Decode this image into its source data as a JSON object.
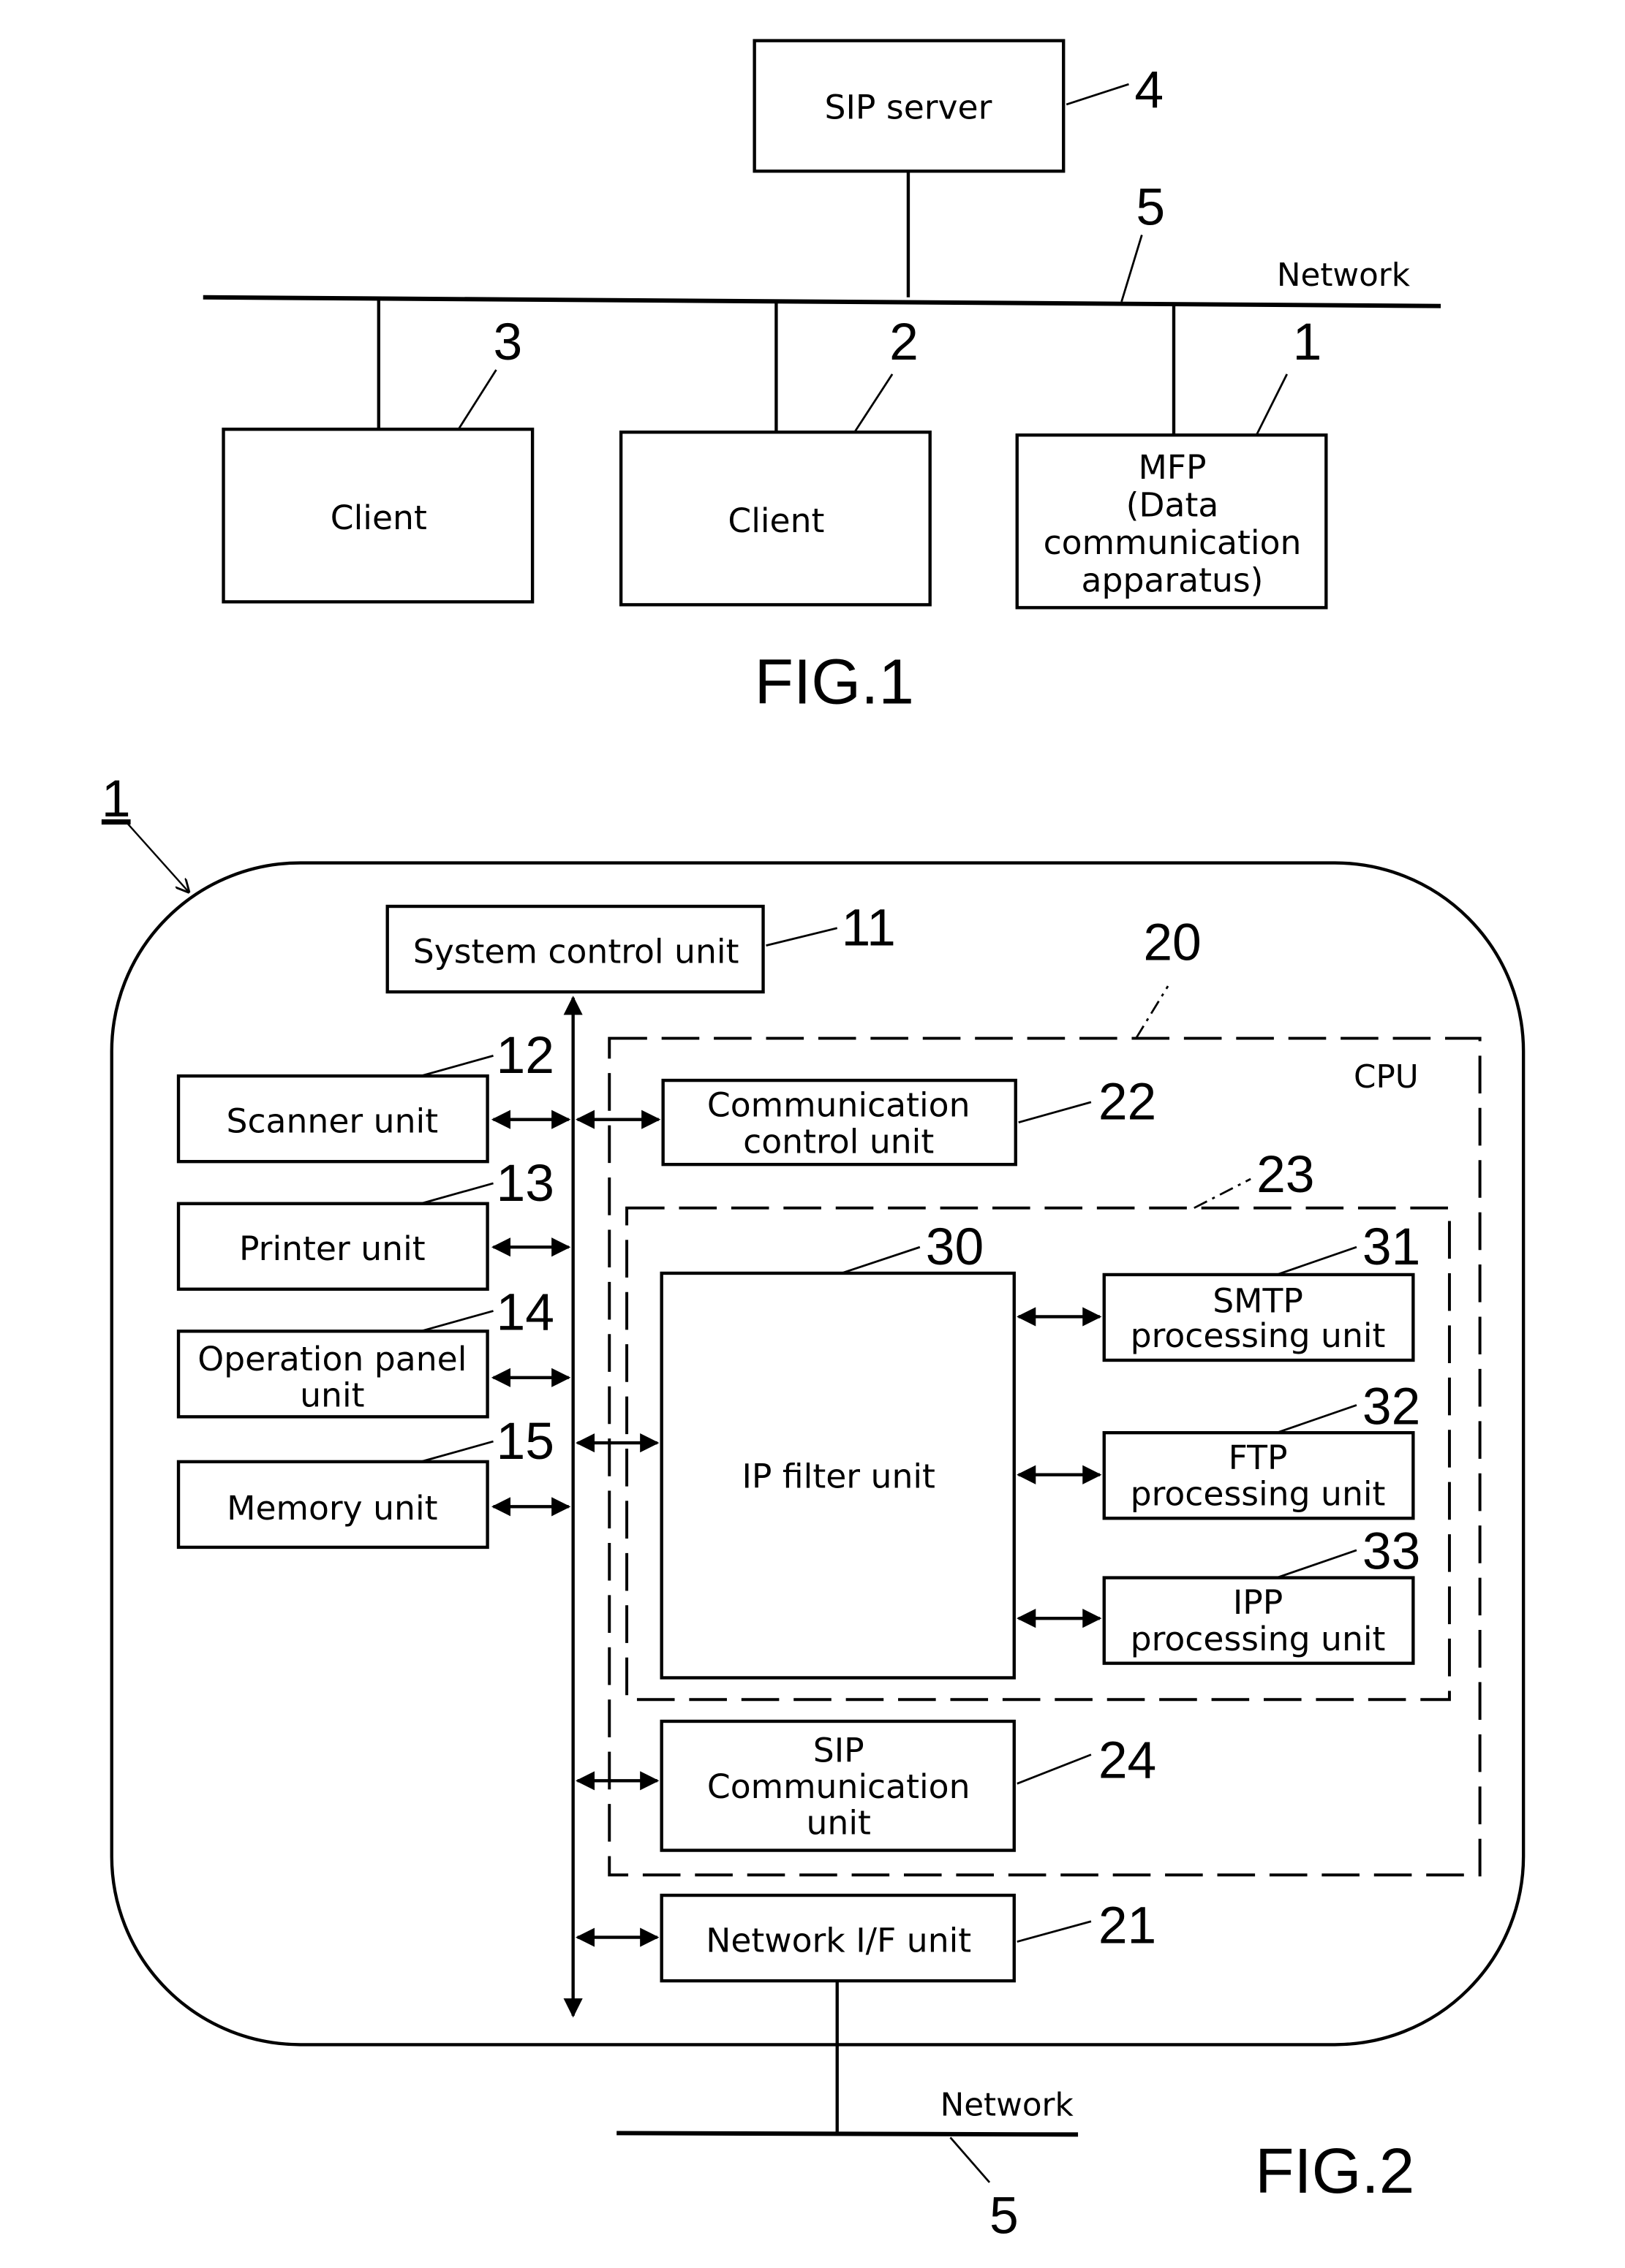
{
  "fig1": {
    "caption": "FIG.1",
    "sip_server": {
      "label": "SIP server",
      "ref": "4"
    },
    "network": {
      "label": "Network",
      "ref": "5"
    },
    "client_3": {
      "label": "Client",
      "ref": "3"
    },
    "client_2": {
      "label": "Client",
      "ref": "2"
    },
    "mfp": {
      "lines": [
        "MFP",
        "(Data",
        "communication",
        "apparatus)"
      ],
      "ref": "1"
    }
  },
  "fig2": {
    "caption": "FIG.2",
    "apparatus_ref": "1",
    "system_control": {
      "label": "System control unit",
      "ref": "11"
    },
    "scanner": {
      "label": "Scanner unit",
      "ref": "12"
    },
    "printer": {
      "label": "Printer unit",
      "ref": "13"
    },
    "operation_panel": {
      "lines": [
        "Operation panel",
        "unit"
      ],
      "ref": "14"
    },
    "memory": {
      "label": "Memory unit",
      "ref": "15"
    },
    "cpu": {
      "label": "CPU",
      "ref": "20"
    },
    "comm_control": {
      "lines": [
        "Communication",
        "control unit"
      ],
      "ref": "22"
    },
    "filter_group_ref": "23",
    "ip_filter": {
      "label": "IP filter unit",
      "ref": "30"
    },
    "smtp": {
      "lines": [
        "SMTP",
        "processing unit"
      ],
      "ref": "31"
    },
    "ftp": {
      "lines": [
        "FTP",
        "processing unit"
      ],
      "ref": "32"
    },
    "ipp": {
      "lines": [
        "IPP",
        "processing unit"
      ],
      "ref": "33"
    },
    "sip_comm": {
      "lines": [
        "SIP",
        "Communication",
        "unit"
      ],
      "ref": "24"
    },
    "network_if": {
      "label": "Network I/F unit",
      "ref": "21"
    },
    "network": {
      "label": "Network",
      "ref": "5"
    }
  }
}
